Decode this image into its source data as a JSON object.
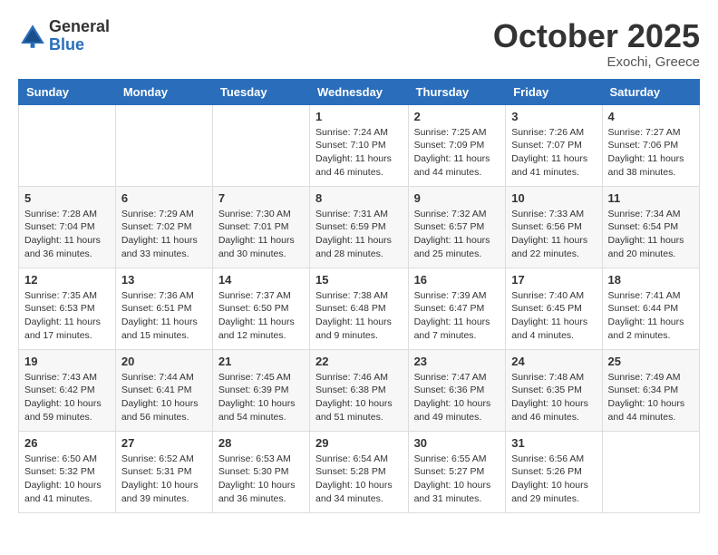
{
  "logo": {
    "general": "General",
    "blue": "Blue"
  },
  "title": {
    "month": "October 2025",
    "location": "Exochi, Greece"
  },
  "headers": [
    "Sunday",
    "Monday",
    "Tuesday",
    "Wednesday",
    "Thursday",
    "Friday",
    "Saturday"
  ],
  "weeks": [
    [
      {
        "day": "",
        "info": ""
      },
      {
        "day": "",
        "info": ""
      },
      {
        "day": "",
        "info": ""
      },
      {
        "day": "1",
        "info": "Sunrise: 7:24 AM\nSunset: 7:10 PM\nDaylight: 11 hours\nand 46 minutes."
      },
      {
        "day": "2",
        "info": "Sunrise: 7:25 AM\nSunset: 7:09 PM\nDaylight: 11 hours\nand 44 minutes."
      },
      {
        "day": "3",
        "info": "Sunrise: 7:26 AM\nSunset: 7:07 PM\nDaylight: 11 hours\nand 41 minutes."
      },
      {
        "day": "4",
        "info": "Sunrise: 7:27 AM\nSunset: 7:06 PM\nDaylight: 11 hours\nand 38 minutes."
      }
    ],
    [
      {
        "day": "5",
        "info": "Sunrise: 7:28 AM\nSunset: 7:04 PM\nDaylight: 11 hours\nand 36 minutes."
      },
      {
        "day": "6",
        "info": "Sunrise: 7:29 AM\nSunset: 7:02 PM\nDaylight: 11 hours\nand 33 minutes."
      },
      {
        "day": "7",
        "info": "Sunrise: 7:30 AM\nSunset: 7:01 PM\nDaylight: 11 hours\nand 30 minutes."
      },
      {
        "day": "8",
        "info": "Sunrise: 7:31 AM\nSunset: 6:59 PM\nDaylight: 11 hours\nand 28 minutes."
      },
      {
        "day": "9",
        "info": "Sunrise: 7:32 AM\nSunset: 6:57 PM\nDaylight: 11 hours\nand 25 minutes."
      },
      {
        "day": "10",
        "info": "Sunrise: 7:33 AM\nSunset: 6:56 PM\nDaylight: 11 hours\nand 22 minutes."
      },
      {
        "day": "11",
        "info": "Sunrise: 7:34 AM\nSunset: 6:54 PM\nDaylight: 11 hours\nand 20 minutes."
      }
    ],
    [
      {
        "day": "12",
        "info": "Sunrise: 7:35 AM\nSunset: 6:53 PM\nDaylight: 11 hours\nand 17 minutes."
      },
      {
        "day": "13",
        "info": "Sunrise: 7:36 AM\nSunset: 6:51 PM\nDaylight: 11 hours\nand 15 minutes."
      },
      {
        "day": "14",
        "info": "Sunrise: 7:37 AM\nSunset: 6:50 PM\nDaylight: 11 hours\nand 12 minutes."
      },
      {
        "day": "15",
        "info": "Sunrise: 7:38 AM\nSunset: 6:48 PM\nDaylight: 11 hours\nand 9 minutes."
      },
      {
        "day": "16",
        "info": "Sunrise: 7:39 AM\nSunset: 6:47 PM\nDaylight: 11 hours\nand 7 minutes."
      },
      {
        "day": "17",
        "info": "Sunrise: 7:40 AM\nSunset: 6:45 PM\nDaylight: 11 hours\nand 4 minutes."
      },
      {
        "day": "18",
        "info": "Sunrise: 7:41 AM\nSunset: 6:44 PM\nDaylight: 11 hours\nand 2 minutes."
      }
    ],
    [
      {
        "day": "19",
        "info": "Sunrise: 7:43 AM\nSunset: 6:42 PM\nDaylight: 10 hours\nand 59 minutes."
      },
      {
        "day": "20",
        "info": "Sunrise: 7:44 AM\nSunset: 6:41 PM\nDaylight: 10 hours\nand 56 minutes."
      },
      {
        "day": "21",
        "info": "Sunrise: 7:45 AM\nSunset: 6:39 PM\nDaylight: 10 hours\nand 54 minutes."
      },
      {
        "day": "22",
        "info": "Sunrise: 7:46 AM\nSunset: 6:38 PM\nDaylight: 10 hours\nand 51 minutes."
      },
      {
        "day": "23",
        "info": "Sunrise: 7:47 AM\nSunset: 6:36 PM\nDaylight: 10 hours\nand 49 minutes."
      },
      {
        "day": "24",
        "info": "Sunrise: 7:48 AM\nSunset: 6:35 PM\nDaylight: 10 hours\nand 46 minutes."
      },
      {
        "day": "25",
        "info": "Sunrise: 7:49 AM\nSunset: 6:34 PM\nDaylight: 10 hours\nand 44 minutes."
      }
    ],
    [
      {
        "day": "26",
        "info": "Sunrise: 6:50 AM\nSunset: 5:32 PM\nDaylight: 10 hours\nand 41 minutes."
      },
      {
        "day": "27",
        "info": "Sunrise: 6:52 AM\nSunset: 5:31 PM\nDaylight: 10 hours\nand 39 minutes."
      },
      {
        "day": "28",
        "info": "Sunrise: 6:53 AM\nSunset: 5:30 PM\nDaylight: 10 hours\nand 36 minutes."
      },
      {
        "day": "29",
        "info": "Sunrise: 6:54 AM\nSunset: 5:28 PM\nDaylight: 10 hours\nand 34 minutes."
      },
      {
        "day": "30",
        "info": "Sunrise: 6:55 AM\nSunset: 5:27 PM\nDaylight: 10 hours\nand 31 minutes."
      },
      {
        "day": "31",
        "info": "Sunrise: 6:56 AM\nSunset: 5:26 PM\nDaylight: 10 hours\nand 29 minutes."
      },
      {
        "day": "",
        "info": ""
      }
    ]
  ]
}
